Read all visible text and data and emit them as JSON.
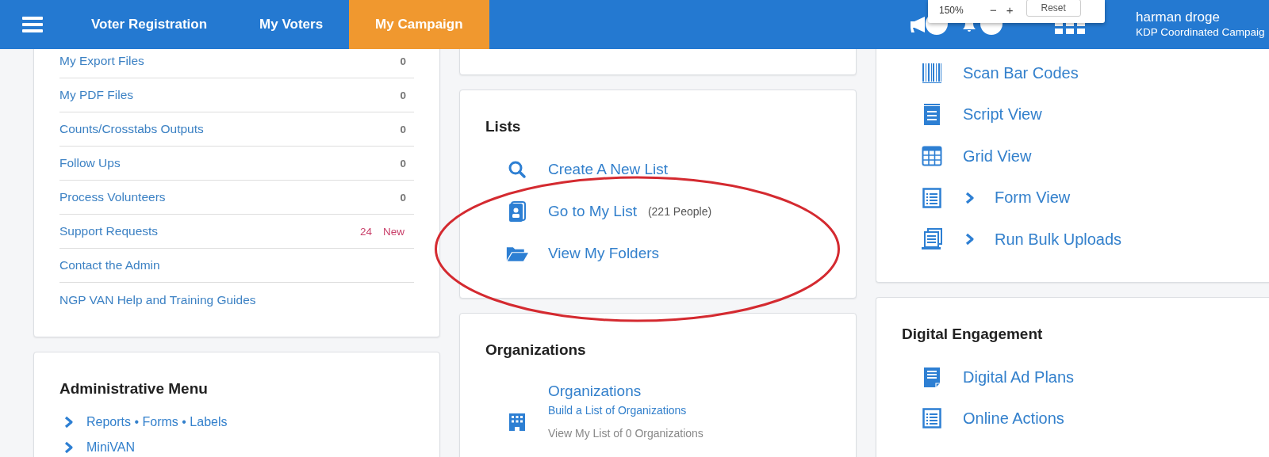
{
  "nav": {
    "tabs": [
      {
        "label": "Voter Registration",
        "selected": false
      },
      {
        "label": "My Voters",
        "selected": false
      },
      {
        "label": "My Campaign",
        "selected": true
      }
    ]
  },
  "zoom_popup": {
    "zoom": "150%",
    "zoom_out": "−",
    "zoom_in": "+",
    "reset": "Reset"
  },
  "user": {
    "name": "harman droge",
    "committee": "KDP Coordinated Campaig"
  },
  "files_card": {
    "rows": [
      {
        "label": "My Export Files",
        "count": "0"
      },
      {
        "label": "My PDF Files",
        "count": "0"
      },
      {
        "label": "Counts/Crosstabs Outputs",
        "count": "0"
      },
      {
        "label": "Follow Ups",
        "count": "0"
      },
      {
        "label": "Process Volunteers",
        "count": "0"
      },
      {
        "label": "Support Requests",
        "count": "24",
        "flag": "New"
      },
      {
        "label": "Contact the Admin"
      },
      {
        "label": "NGP VAN Help and Training Guides"
      }
    ]
  },
  "admin_card": {
    "title": "Administrative Menu",
    "items": [
      "Reports • Forms • Labels",
      "MiniVAN"
    ]
  },
  "lists_card": {
    "title": "Lists",
    "items": [
      {
        "label": "Create A New List"
      },
      {
        "label": "Go to My List",
        "count": "(221 People)"
      },
      {
        "label": "View My Folders"
      }
    ]
  },
  "organizations_card": {
    "title": "Organizations",
    "item": {
      "title": "Organizations",
      "subtitle": "Build a List of Organizations",
      "detail": "View My List of 0 Organizations"
    }
  },
  "tools_card": {
    "items": [
      {
        "label": "Scan Bar Codes",
        "kind": "link"
      },
      {
        "label": "Script View",
        "kind": "link"
      },
      {
        "label": "Grid View",
        "kind": "link"
      },
      {
        "label": "Form View",
        "kind": "submenu"
      },
      {
        "label": "Run Bulk Uploads",
        "kind": "submenu"
      }
    ]
  },
  "digital_card": {
    "title": "Digital Engagement",
    "items": [
      "Digital Ad Plans",
      "Online Actions"
    ]
  },
  "annotations": [
    {
      "kind": "ellipse"
    }
  ]
}
